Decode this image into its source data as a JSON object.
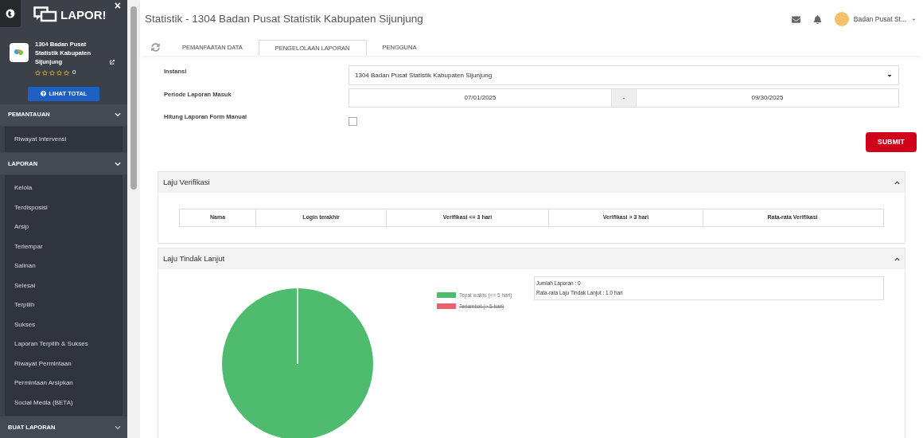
{
  "sidebar": {
    "logo": "LAPOR!",
    "close": "×",
    "profile": {
      "name": "1304 Badan Pusat Statistik Kabupaten Sijunjung",
      "stars": 0,
      "rating": "0"
    },
    "total_button": "LIHAT TOTAL",
    "sections": [
      {
        "title": "PEMANTAUAN",
        "expanded": true,
        "items": [
          "Riwayat Intervensi"
        ]
      },
      {
        "title": "LAPORAN",
        "expanded": true,
        "items": [
          "Kelola",
          "Terdisposisi",
          "Arsip",
          "Terlempar",
          "Salinan",
          "Selesai",
          "Terpilih",
          "Sukses",
          "Laporan Terpilih & Sukses",
          "Riwayat Permintaan",
          "Permintaan Arsipkan",
          "Social Media (BETA)"
        ]
      },
      {
        "title": "BUAT LAPORAN",
        "expanded": false
      }
    ]
  },
  "header": {
    "title": "Statistik - 1304 Badan Pusat Statistik Kabupaten Sijunjung",
    "user": "Badan Pusat St...",
    "tabs": [
      {
        "label": "PEMANFAATAN DATA",
        "selected": false
      },
      {
        "label": "PENGELOLAAN LAPORAN",
        "selected": true
      },
      {
        "label": "PENGGUNA",
        "selected": false
      }
    ]
  },
  "form": {
    "instansi_label": "Instansi",
    "instansi_value": "1304 Badan Pusat Statistik Kabupaten Sijunjung",
    "periode_label": "Periode Laporan Masuk",
    "date_from": "07/01/2025",
    "date_sep": "-",
    "date_to": "09/30/2025",
    "manual_label": "Hitung Laporan Form Manual",
    "manual_checked": false,
    "submit": "SUBMIT"
  },
  "verifikasi": {
    "title": "Laju Verifikasi",
    "expanded": true,
    "columns": [
      "Nama",
      "Login terakhir",
      "Verifikasi <= 3 hari",
      "Verifikasi > 3 hari",
      "Rata-rata Verifikasi"
    ]
  },
  "tindak_lanjut": {
    "title": "Laju Tindak Lanjut",
    "expanded": true,
    "legend": [
      {
        "label": "Tepat waktu (<= 5 hari)",
        "color": "#4fbb6f",
        "hidden": false
      },
      {
        "label": "Terlambat (> 5 hari)",
        "color": "#e8616b",
        "hidden": true
      }
    ],
    "summary": [
      "Jumlah Laporan : 0",
      "Rata-rata Laju Tindak Lanjut : 1.0 hari"
    ]
  }
}
